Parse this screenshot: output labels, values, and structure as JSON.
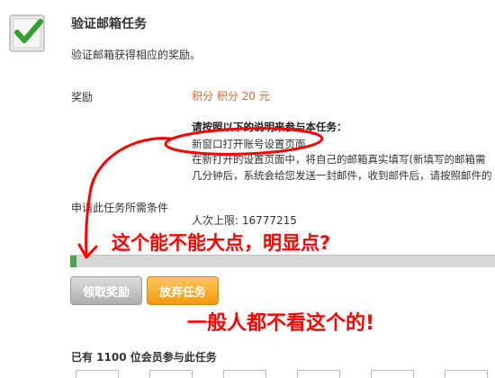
{
  "task": {
    "title": "验证邮箱任务",
    "description": "验证邮箱获得相应的奖励。"
  },
  "reward": {
    "label": "奖励",
    "value": "积分 积分 20 元"
  },
  "instructions": {
    "title": "请按照以下的说明来参与本任务：",
    "lines": [
      "新窗口打开账号设置页面",
      "在新打开的设置页面中，将自己的邮箱真实填写(新填写的邮箱需",
      "几分钟后，系统会给您发送一封邮件，收到邮件后，请按照邮件的"
    ]
  },
  "conditions": {
    "label": "申请此任务所需条件",
    "limit": "人次上限: 16777215"
  },
  "progress": {
    "fraction": 0.015,
    "color": "#4aa54a"
  },
  "buttons": {
    "claim": "领取奖励",
    "abandon": "放弃任务"
  },
  "annotations": {
    "bigger": "这个能不能大点，明显点?",
    "nobody_reads": "一般人都不看这个的!",
    "color": "#ff0000"
  },
  "participants": {
    "text": "已有 1100 位会员参与此任务"
  },
  "icons": {
    "task": "checkmark-icon"
  }
}
